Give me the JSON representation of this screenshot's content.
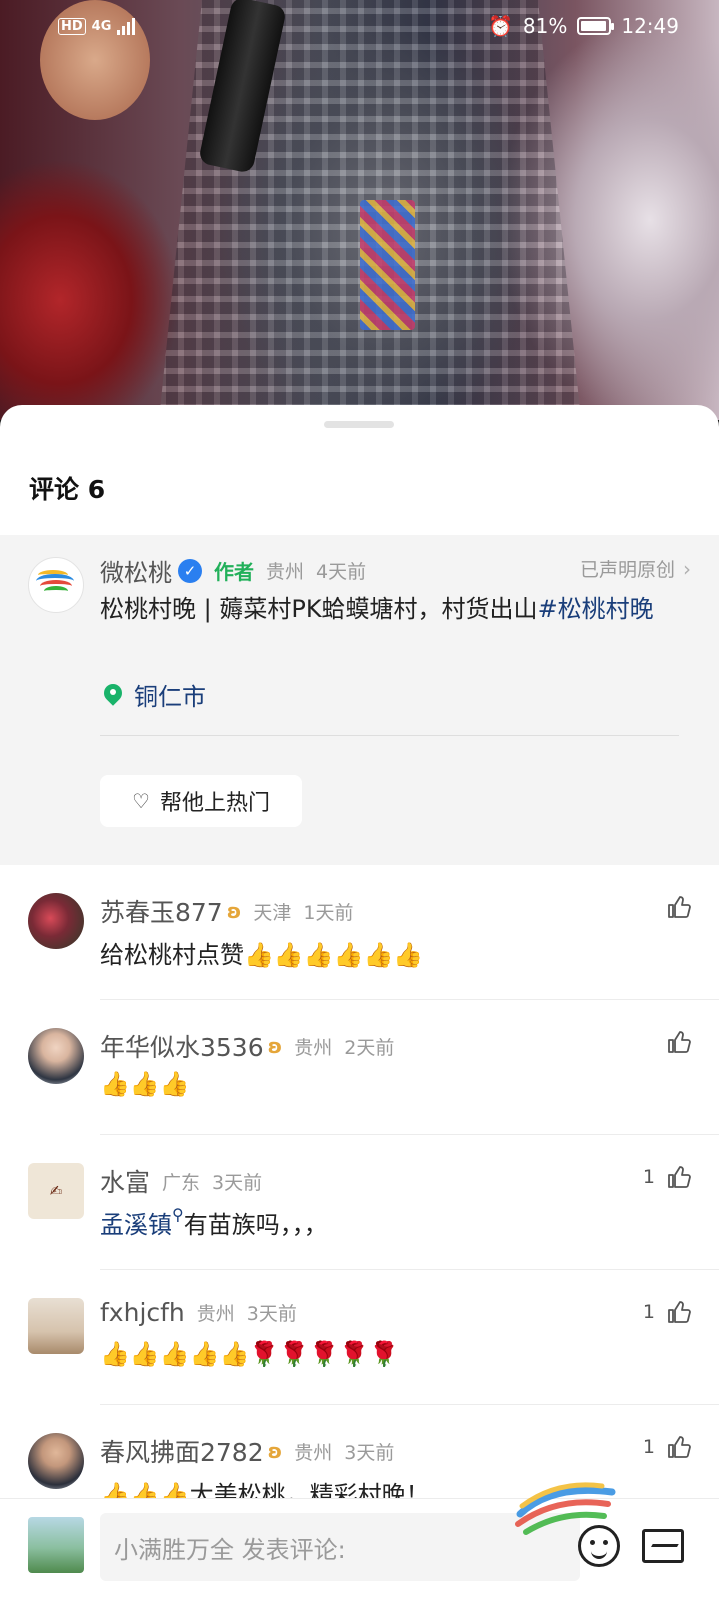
{
  "status_bar": {
    "network": "HD",
    "net_type": "4G",
    "battery": "81%",
    "time": "12:49"
  },
  "sheet": {
    "title": "评论 6"
  },
  "post": {
    "author": "微松桃",
    "author_tag": "作者",
    "region": "贵州",
    "time": "4天前",
    "original": "已声明原创",
    "text_plain": "松桃村晚 | 薅菜村PK蛤蟆塘村，村货出山",
    "hashtag": "#松桃村晚",
    "location": "铜仁市",
    "promo_button": "帮他上热门"
  },
  "comments": [
    {
      "name": "苏春玉877",
      "badge": true,
      "region": "天津",
      "time": "1天前",
      "text": "给松桃村点赞",
      "emoji": "👍👍👍👍👍👍",
      "likes": ""
    },
    {
      "name": "年华似水3536",
      "badge": true,
      "region": "贵州",
      "time": "2天前",
      "text": "",
      "emoji": "👍👍👍",
      "likes": ""
    },
    {
      "name": "水富",
      "badge": false,
      "region": "广东",
      "time": "3天前",
      "topic": "孟溪镇",
      "text": "有苗族吗，，，",
      "emoji": "",
      "likes": "1"
    },
    {
      "name": "fxhjcfh",
      "badge": false,
      "region": "贵州",
      "time": "3天前",
      "text": "",
      "emoji": "👍👍👍👍👍🌹🌹🌹🌹🌹",
      "likes": "1"
    },
    {
      "name": "春风拂面2782",
      "badge": true,
      "region": "贵州",
      "time": "3天前",
      "text": "大美松桃，精彩村晚！",
      "emoji": "👍👍👍",
      "likes": "1"
    }
  ],
  "input": {
    "placeholder": "小满胜万全 发表评论:"
  },
  "colors": {
    "link": "#1a3e7a",
    "author_tag": "#22b05a",
    "verified": "#2a7ff0",
    "meta": "#9a9a9a"
  }
}
